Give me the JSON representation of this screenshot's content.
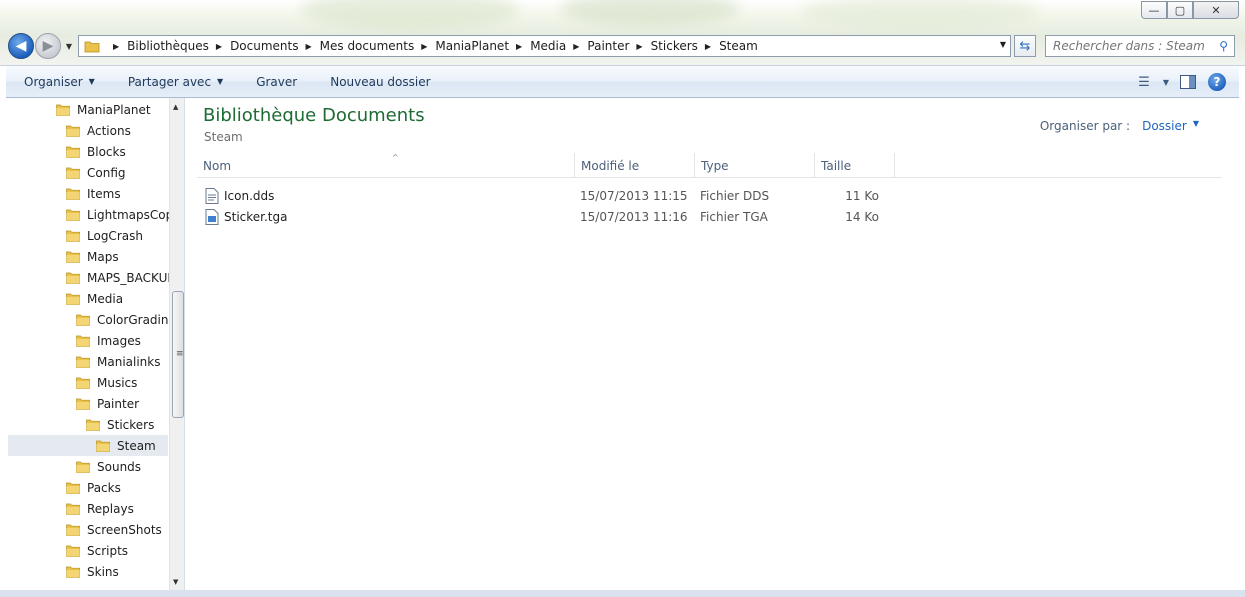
{
  "address": {
    "crumbs": [
      "Bibliothèques",
      "Documents",
      "Mes documents",
      "ManiaPlanet",
      "Media",
      "Painter",
      "Stickers",
      "Steam"
    ]
  },
  "search": {
    "placeholder": "Rechercher dans : Steam"
  },
  "toolbar": {
    "organize": "Organiser",
    "share": "Partager avec",
    "burn": "Graver",
    "new_folder": "Nouveau dossier"
  },
  "tree": [
    {
      "label": "ManiaPlanet",
      "level": 0
    },
    {
      "label": "Actions",
      "level": 1
    },
    {
      "label": "Blocks",
      "level": 1
    },
    {
      "label": "Config",
      "level": 1
    },
    {
      "label": "Items",
      "level": 1
    },
    {
      "label": "LightmapsCop",
      "level": 1
    },
    {
      "label": "LogCrash",
      "level": 1
    },
    {
      "label": "Maps",
      "level": 1
    },
    {
      "label": "MAPS_BACKUF",
      "level": 1
    },
    {
      "label": "Media",
      "level": 1
    },
    {
      "label": "ColorGrading",
      "level": 2
    },
    {
      "label": "Images",
      "level": 2
    },
    {
      "label": "Manialinks",
      "level": 2
    },
    {
      "label": "Musics",
      "level": 2
    },
    {
      "label": "Painter",
      "level": 2
    },
    {
      "label": "Stickers",
      "level": 3
    },
    {
      "label": "Steam",
      "level": 4,
      "selected": true
    },
    {
      "label": "Sounds",
      "level": 2
    },
    {
      "label": "Packs",
      "level": 1
    },
    {
      "label": "Replays",
      "level": 1
    },
    {
      "label": "ScreenShots",
      "level": 1
    },
    {
      "label": "Scripts",
      "level": 1
    },
    {
      "label": "Skins",
      "level": 1
    }
  ],
  "library": {
    "title": "Bibliothèque Documents",
    "subtitle": "Steam",
    "arrange_label": "Organiser par :",
    "arrange_value": "Dossier"
  },
  "columns": {
    "name": "Nom",
    "modified": "Modifié le",
    "type": "Type",
    "size": "Taille"
  },
  "files": [
    {
      "name": "Icon.dds",
      "modified": "15/07/2013 11:15",
      "type": "Fichier DDS",
      "size": "11 Ko",
      "icon": "dds-file-icon"
    },
    {
      "name": "Sticker.tga",
      "modified": "15/07/2013 11:16",
      "type": "Fichier TGA",
      "size": "14 Ko",
      "icon": "tga-file-icon"
    }
  ],
  "colors": {
    "title_green": "#1e6b34",
    "link_blue": "#1e66c1",
    "folder_yellow": "#e8c24a"
  }
}
